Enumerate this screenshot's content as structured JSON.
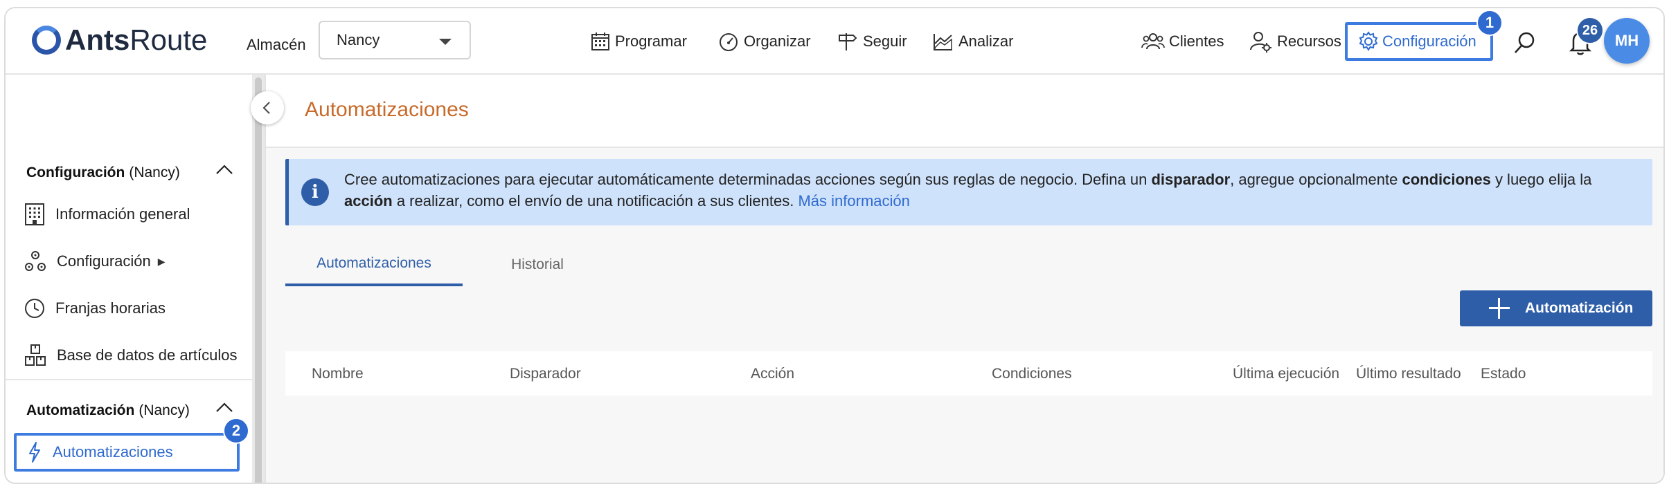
{
  "app": {
    "logo_bold": "Ants",
    "logo_light": "Route"
  },
  "header": {
    "warehouse_label": "Almacén",
    "warehouse_value": "Nancy",
    "nav": {
      "schedule": "Programar",
      "organize": "Organizar",
      "track": "Seguir",
      "analyze": "Analizar",
      "clients": "Clientes",
      "resources": "Recursos",
      "configuration": "Configuración"
    },
    "config_badge": "1",
    "notifications_count": "26",
    "avatar_initials": "MH"
  },
  "sidebar": {
    "config_section_title": "Configuración",
    "config_section_context": "(Nancy)",
    "items": [
      {
        "label": "Información general"
      },
      {
        "label": "Configuración"
      },
      {
        "label": "Franjas horarias"
      },
      {
        "label": "Base de datos de artículos"
      }
    ],
    "submenu_arrow": "▶",
    "automation_section_title": "Automatización",
    "automation_section_context": "(Nancy)",
    "active_item": "Automatizaciones",
    "active_badge": "2"
  },
  "main": {
    "page_title": "Automatizaciones",
    "info": {
      "text1": "Cree automatizaciones para ejecutar automáticamente determinadas acciones según sus reglas de negocio. Defina un ",
      "bold1": "disparador",
      "text2": ", agregue opcionalmente ",
      "bold2": "condiciones",
      "text3": " y luego elija la ",
      "bold3": "acción",
      "text4": " a realizar, como el envío de una notificación a sus clientes. ",
      "link": "Más información"
    },
    "tabs": [
      {
        "label": "Automatizaciones"
      },
      {
        "label": "Historial"
      }
    ],
    "add_button": "Automatización",
    "table_columns": [
      "Nombre",
      "Disparador",
      "Acción",
      "Condiciones",
      "Última ejecución",
      "Último resultado",
      "Estado"
    ]
  },
  "colors": {
    "brand": "#2f5ea8",
    "highlight": "#3d7be0",
    "title_orange": "#c86a2a",
    "info_bg": "#cfe2fb"
  }
}
